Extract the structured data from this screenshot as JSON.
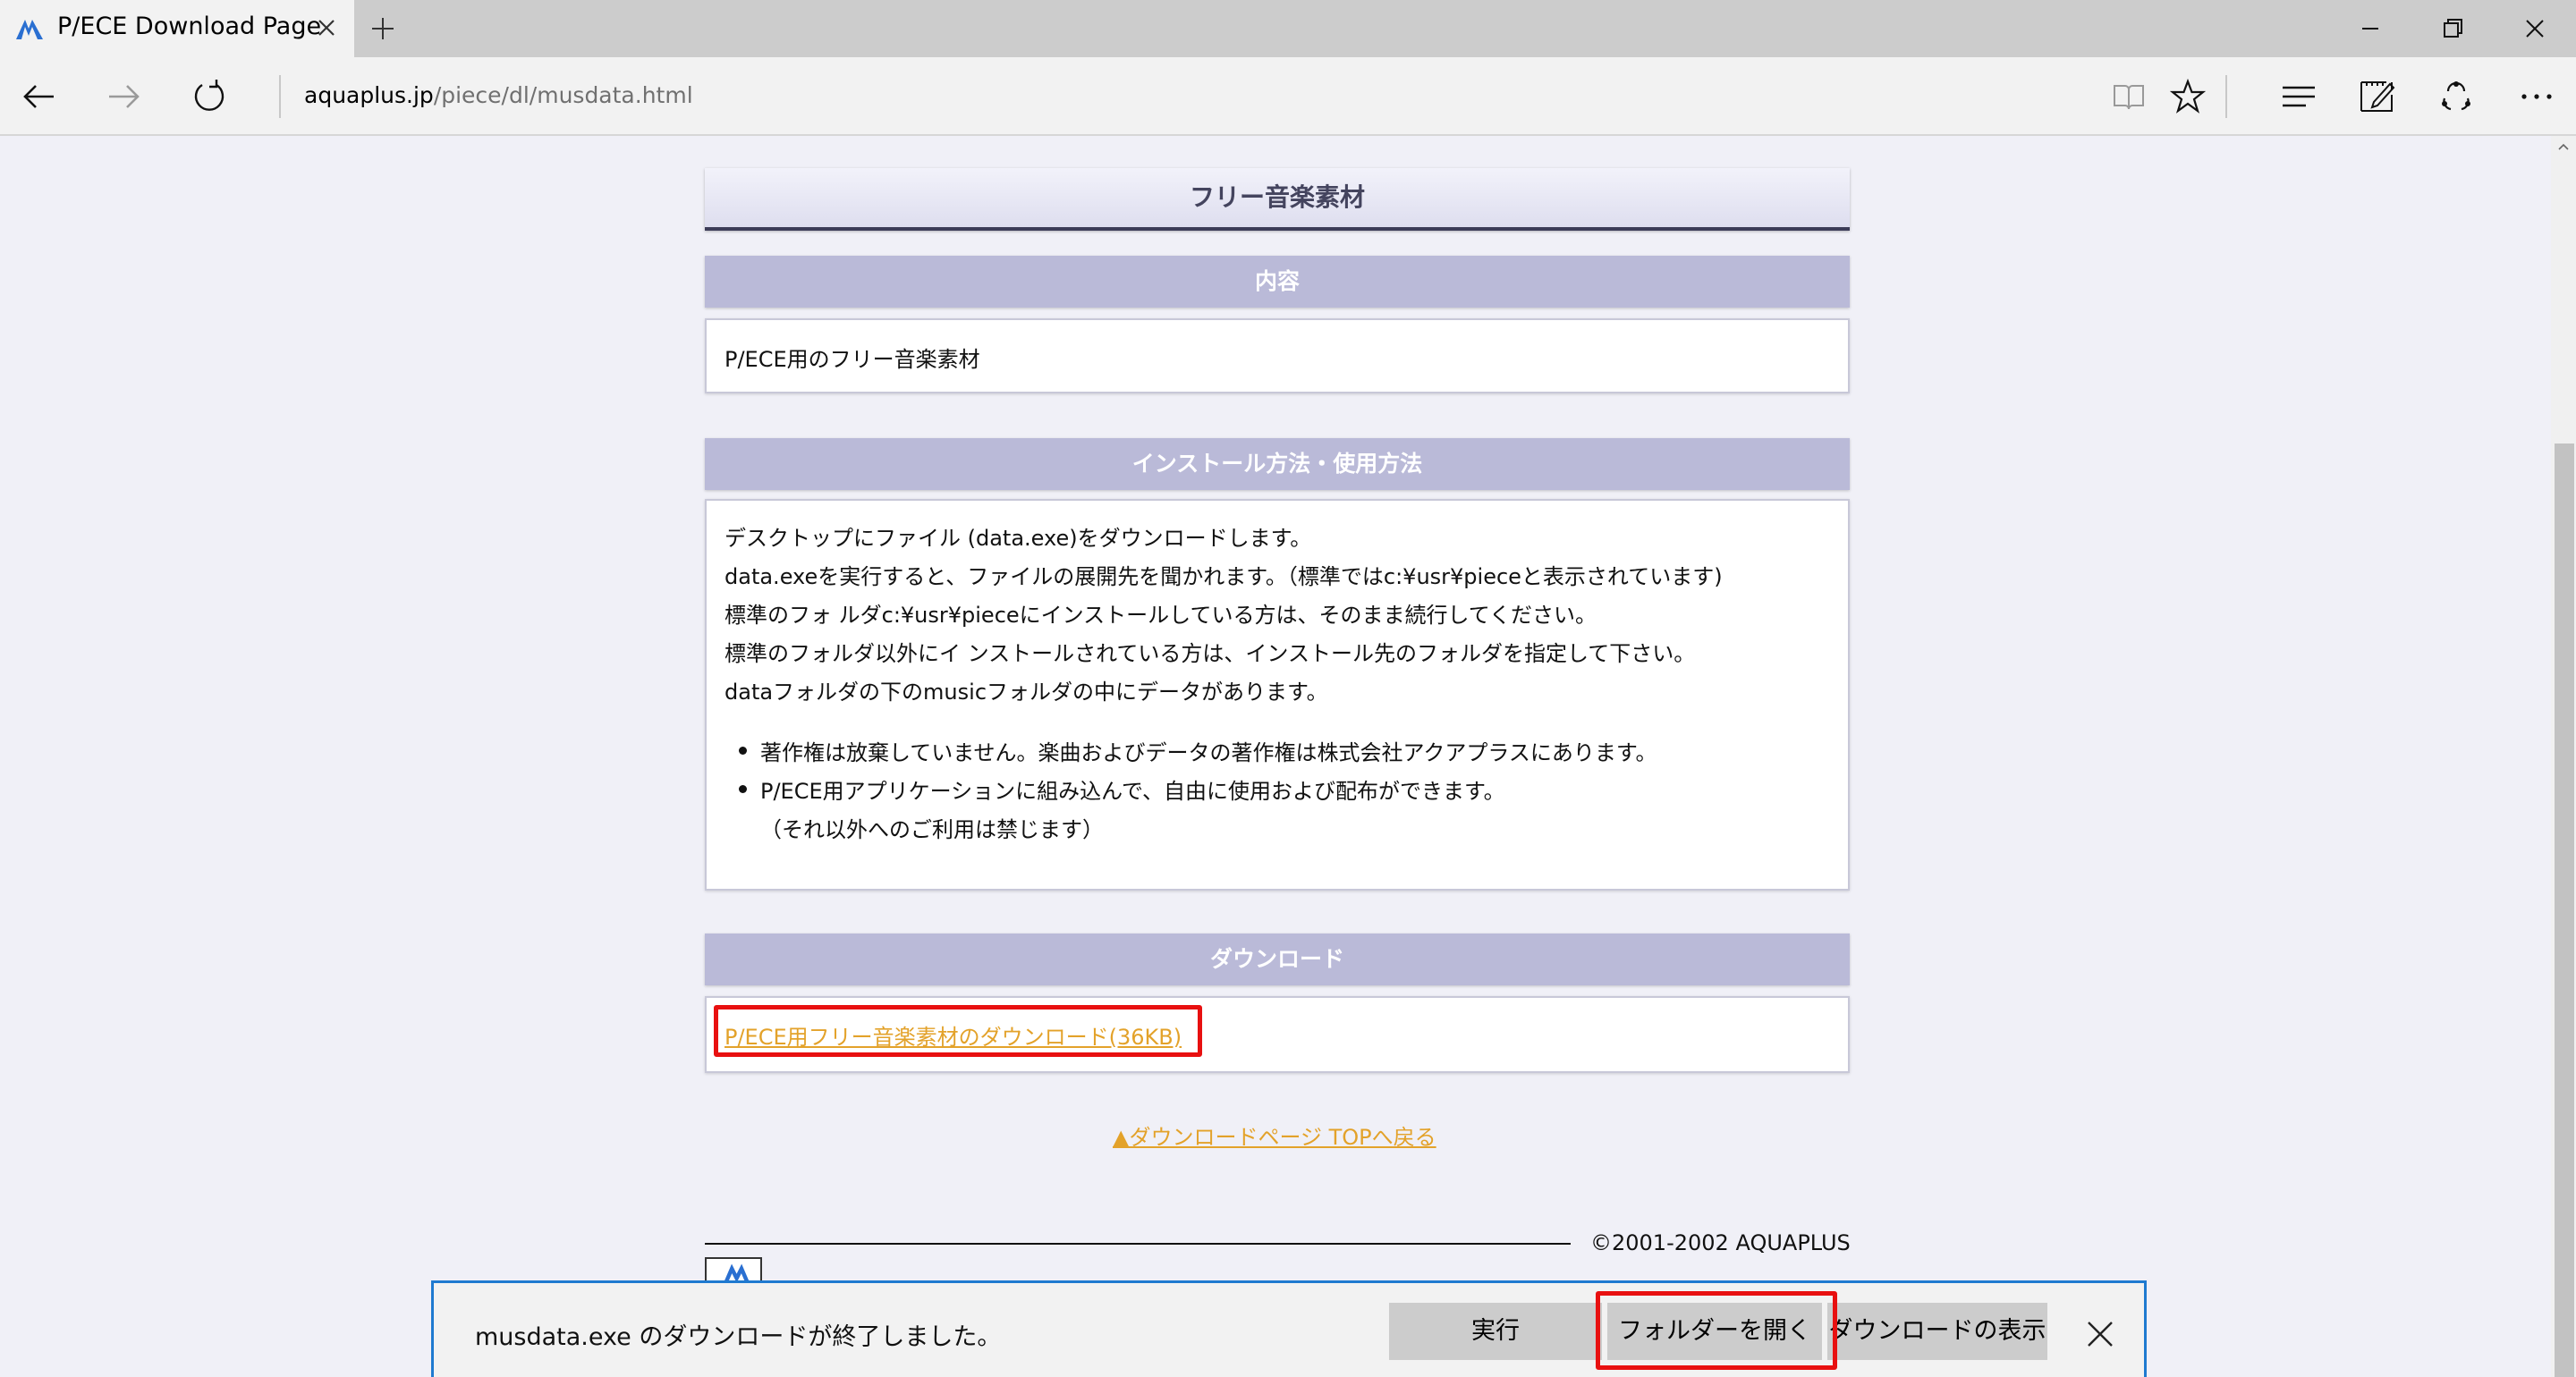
{
  "tab": {
    "title": "P/ECE Download Page"
  },
  "address": {
    "host": "aquaplus.jp",
    "path": "/piece/dl/musdata.html"
  },
  "page": {
    "title": "フリー音楽素材",
    "sections": {
      "content": {
        "heading": "内容",
        "text": "P/ECE用のフリー音楽素材"
      },
      "install": {
        "heading": "インストール方法・使用方法",
        "lines": [
          "デスクトップにファイル (data.exe)をダウンロードします。",
          "data.exeを実行すると、ファイルの展開先を聞かれます。（標準ではc:¥usr¥pieceと表示されています)",
          "標準のフォ ルダc:¥usr¥pieceにインストールしている方は、そのまま続行してください。",
          "標準のフォルダ以外にイ ンストールされている方は、インストール先のフォルダを指定して下さい。",
          "dataフォルダの下のmusicフォルダの中にデータがあります。"
        ],
        "bullets": [
          "著作権は放棄していません。楽曲およびデータの著作権は株式会社アクアプラスにあります。",
          "P/ECE用アプリケーションに組み込んで、自由に使用および配布ができます。"
        ],
        "note": "（それ以外へのご利用は禁じます）"
      },
      "download": {
        "heading": "ダウンロード",
        "link": "P/ECE用フリー音楽素材のダウンロード(36KB)"
      }
    },
    "back_link": "▲ダウンロードページ TOPへ戻る",
    "copyright": "©2001-2002 AQUAPLUS"
  },
  "download_bar": {
    "message": "musdata.exe のダウンロードが終了しました。",
    "run_label": "実行",
    "open_folder_label": "フォルダーを開く",
    "view_downloads_label": "ダウンロードの表示"
  },
  "colors": {
    "link": "#e3a22a",
    "section_header": "#babad8",
    "highlight": "#e81010",
    "download_bar_border": "#1f7ad0"
  }
}
